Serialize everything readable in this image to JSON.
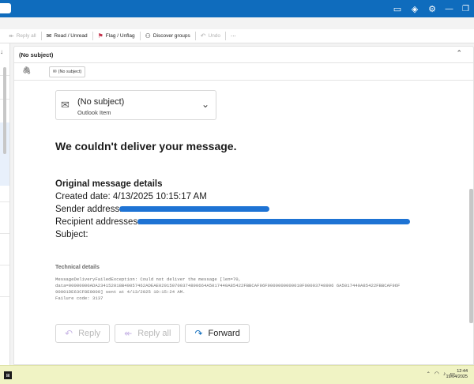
{
  "titlebar": {
    "icons": [
      "present-icon",
      "diamond-icon",
      "gear-icon",
      "minimize-icon",
      "restore-icon"
    ],
    "color": "#0f6cbd"
  },
  "ribbon": {
    "reply_all": "Reply all",
    "read_unread": "Read / Unread",
    "flag_unflag": "Flag / Unflag",
    "discover_groups": "Discover groups",
    "undo": "Undo",
    "more": "···"
  },
  "reading_pane": {
    "subject": "(No subject)",
    "attachment_chip": "(No subject)",
    "item_card": {
      "title": "(No subject)",
      "subtitle": "Outlook Item"
    },
    "headline": "We couldn't deliver your message.",
    "original_details": {
      "title": "Original message details",
      "created_date": "Created date: 4/13/2025 10:15:17 AM",
      "sender_label": "Sender address:",
      "recipient_label": "Recipient addresses:",
      "subject_label": "Subject:"
    },
    "technical": {
      "title": "Technical details",
      "text": "MessageDeliveryFailedException: Could not deliver the message [len=70,\ndata=00000000ADA234152018B40057462ADEAE029150700374890664A5017440A85422FBBCAF96F9000000000010F00003748906 6A5017440A85422FBBCAF96F\n90001DE63CF8E0000] sent at 4/13/2025 10:15:24 AM.\nFailure code: 3137"
    },
    "actions": {
      "reply": "Reply",
      "reply_all": "Reply all",
      "forward": "Forward"
    }
  },
  "taskbar": {
    "time": "12:44",
    "date": "19/04/2025"
  },
  "colors": {
    "accent": "#0f6cbd",
    "redaction": "#1e73d4",
    "taskbar": "#f0f3c4"
  }
}
